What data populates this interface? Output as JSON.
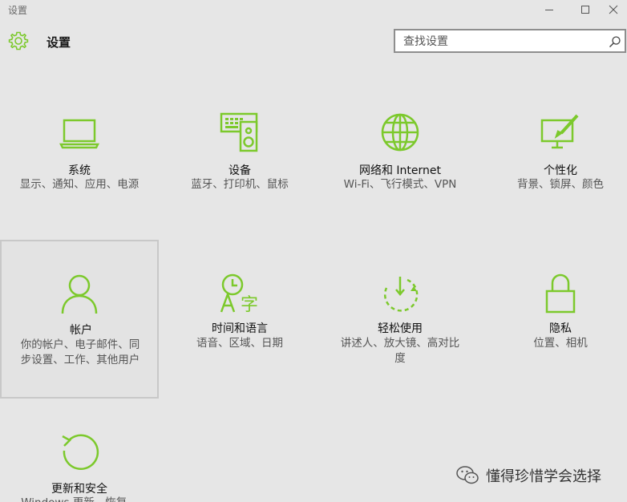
{
  "window": {
    "title": "设置"
  },
  "header": {
    "title": "设置"
  },
  "search": {
    "placeholder": "查找设置"
  },
  "accent_color": "#7cc92c",
  "tiles": [
    {
      "icon": "laptop-icon",
      "title": "系统",
      "desc": "显示、通知、应用、电源"
    },
    {
      "icon": "keyboard-speaker-icon",
      "title": "设备",
      "desc": "蓝牙、打印机、鼠标"
    },
    {
      "icon": "globe-icon",
      "title": "网络和 Internet",
      "desc": "Wi-Fi、飞行模式、VPN"
    },
    {
      "icon": "monitor-paintbrush-icon",
      "title": "个性化",
      "desc": "背景、锁屏、颜色"
    },
    {
      "icon": "person-icon",
      "title": "帐户",
      "desc": "你的帐户、电子邮件、同步设置、工作、其他用户"
    },
    {
      "icon": "clock-language-icon",
      "title": "时间和语言",
      "desc": "语音、区域、日期"
    },
    {
      "icon": "ease-of-access-icon",
      "title": "轻松使用",
      "desc": "讲述人、放大镜、高对比度"
    },
    {
      "icon": "lock-icon",
      "title": "隐私",
      "desc": "位置、相机"
    },
    {
      "icon": "refresh-icon",
      "title": "更新和安全",
      "desc": "Windows 更新、恢复、备份"
    }
  ],
  "watermark": {
    "text": "懂得珍惜学会选择",
    "icon": "wechat-icon"
  }
}
